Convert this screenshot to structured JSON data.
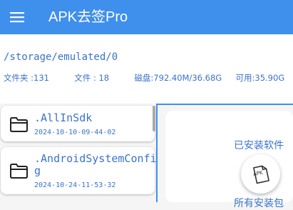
{
  "app": {
    "title": "APK去签Pro"
  },
  "icons": {
    "menu": "hamburger-menu-icon",
    "folder": "folder-icon",
    "fab": "apk-file-icon"
  },
  "colors": {
    "primary": "#3f8fed",
    "text_blue": "#3a73c9"
  },
  "info": {
    "path": "/storage/emulated/0",
    "folders": "文件夹 :131",
    "files": "文件 : 18",
    "disk": "磁盘:792.40M/36.68G",
    "available": "可用:35.90G"
  },
  "entries": [
    {
      "name": ".AllInSdk",
      "date": "2024-10-10-09-44-02"
    },
    {
      "name_line1": ".AndroidSystemConfi",
      "name_line2": "g",
      "date": "2024-10-24-11-53-32"
    }
  ],
  "right_panel": {
    "installed": "已安装软件",
    "all": "所有安装包"
  },
  "fab": {
    "label": "APK"
  }
}
